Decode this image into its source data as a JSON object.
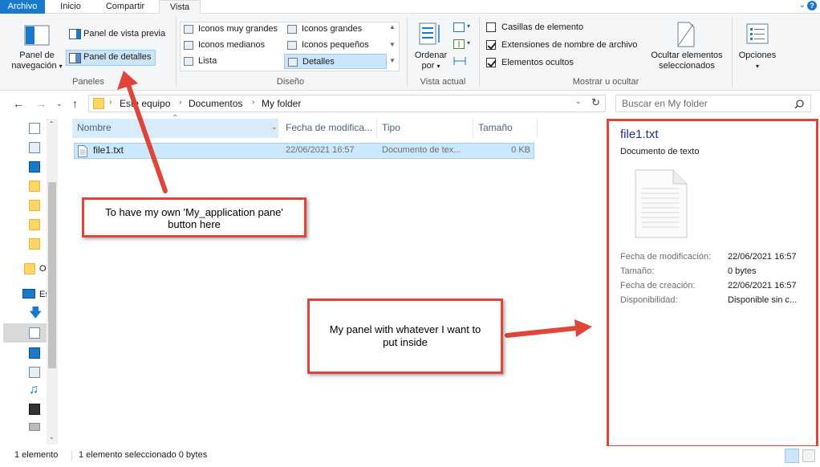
{
  "colors": {
    "accent": "#1979ca",
    "annotation": "#e0453a",
    "selection": "#cce8ff"
  },
  "tabs": [
    {
      "label": "Archivo"
    },
    {
      "label": "Inicio"
    },
    {
      "label": "Compartir"
    },
    {
      "label": "Vista",
      "active": true
    }
  ],
  "ribbon": {
    "panes": {
      "nav_pane_line1": "Panel de",
      "nav_pane_line2": "navegación",
      "preview_pane": "Panel de vista previa",
      "details_pane": "Panel de detalles",
      "group_label": "Paneles"
    },
    "layout": {
      "items": [
        "Iconos muy grandes",
        "Iconos grandes",
        "Iconos medianos",
        "Iconos pequeños",
        "Lista",
        "Detalles"
      ],
      "selected": "Detalles",
      "group_label": "Diseño"
    },
    "current_view": {
      "sort_line1": "Ordenar",
      "sort_line2": "por",
      "group_label": "Vista actual"
    },
    "show_hide": {
      "checkboxes": [
        {
          "label": "Casillas de elemento",
          "checked": false
        },
        {
          "label": "Extensiones de nombre de archivo",
          "checked": true
        },
        {
          "label": "Elementos ocultos",
          "checked": true
        }
      ],
      "hide_selected_line1": "Ocultar elementos",
      "hide_selected_line2": "seleccionados",
      "group_label": "Mostrar u ocultar"
    },
    "options": "Opciones"
  },
  "address": {
    "breadcrumb": [
      "Este equipo",
      "Documentos",
      "My folder"
    ],
    "search_placeholder": "Buscar en My folder"
  },
  "tree": {
    "partial_labels": [
      "O",
      "Es"
    ]
  },
  "file_list": {
    "columns": [
      "Nombre",
      "Fecha de modifica...",
      "Tipo",
      "Tamaño"
    ],
    "rows": [
      {
        "name": "file1.txt",
        "date": "22/06/2021 16:57",
        "type": "Documento de tex...",
        "size": "0 KB"
      }
    ]
  },
  "details_pane": {
    "filename": "file1.txt",
    "type": "Documento de texto",
    "props": [
      {
        "label": "Fecha de modificación:",
        "value": "22/06/2021 16:57"
      },
      {
        "label": "Tamaño:",
        "value": "0 bytes"
      },
      {
        "label": "Fecha de creación:",
        "value": "22/06/2021 16:57"
      },
      {
        "label": "Disponibilidad:",
        "value": "Disponible sin c..."
      }
    ]
  },
  "annotations": {
    "note1": "To have my own 'My_application pane' button here",
    "note2": "My panel with whatever I want to put inside"
  },
  "status": {
    "count": "1 elemento",
    "selection": "1 elemento seleccionado  0 bytes"
  }
}
